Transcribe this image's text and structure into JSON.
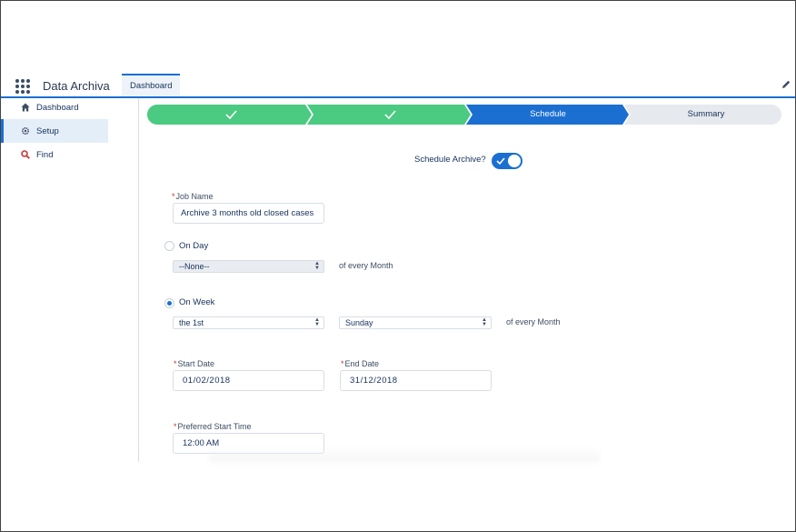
{
  "header": {
    "app_name": "Data Archiva",
    "tab": "Dashboard"
  },
  "sidebar": {
    "items": [
      {
        "label": "Dashboard",
        "icon": "home-icon"
      },
      {
        "label": "Setup",
        "icon": "gear-icon"
      },
      {
        "label": "Find",
        "icon": "search-icon"
      }
    ],
    "active": "Setup"
  },
  "path": {
    "stages": [
      {
        "label": "",
        "status": "complete"
      },
      {
        "label": "",
        "status": "complete"
      },
      {
        "label": "Schedule",
        "status": "current"
      },
      {
        "label": "Summary",
        "status": "upcoming"
      }
    ]
  },
  "form": {
    "schedule_label": "Schedule Archive?",
    "schedule_enabled": true,
    "job_name_label": "Job Name",
    "job_name_value": "Archive 3 months old closed cases",
    "on_day_label": "On Day",
    "on_day_selected": false,
    "day_select": "--None--",
    "of_every_month_1": "of every Month",
    "on_week_label": "On Week",
    "on_week_selected": true,
    "week_select": "the 1st",
    "weekday_select": "Sunday",
    "of_every_month_2": "of every Month",
    "start_date_label": "Start Date",
    "start_date_value": "01/02/2018",
    "end_date_label": "End Date",
    "end_date_value": "31/12/2018",
    "start_time_label": "Preferred Start Time",
    "start_time_value": "12:00 AM",
    "required_marker": "*"
  },
  "colors": {
    "brand": "#1b6fd1",
    "complete": "#4bca81",
    "upcoming": "#e6e9ed",
    "required": "#c23934"
  }
}
